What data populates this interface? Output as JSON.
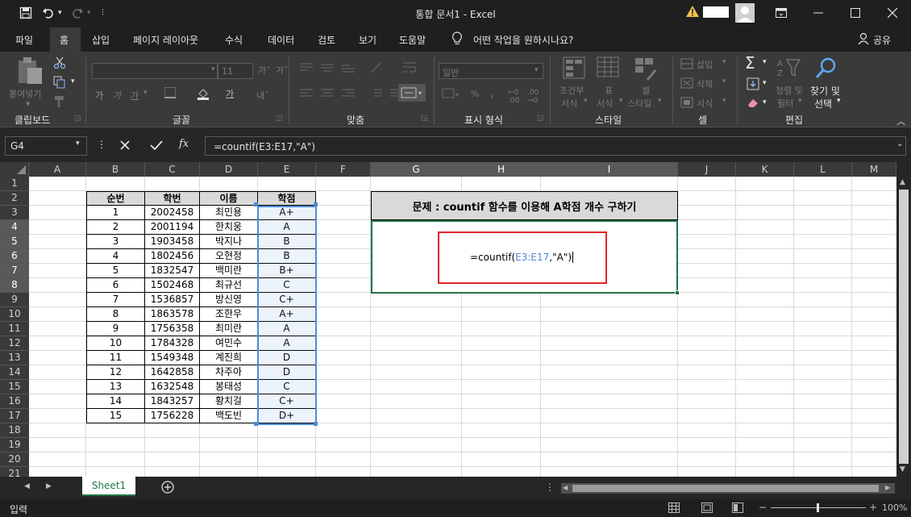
{
  "titlebar": {
    "doc_title": "통합 문서1 - Excel",
    "warning_icon": "warning-icon",
    "account_label": ""
  },
  "menu": {
    "tabs": [
      "파일",
      "홈",
      "삽입",
      "페이지 레이아웃",
      "수식",
      "데이터",
      "검토",
      "보기",
      "도움말"
    ],
    "tell_me": "어떤 작업을 원하시나요?",
    "share": "공유"
  },
  "ribbon": {
    "groups": [
      "클립보드",
      "글꼴",
      "맞춤",
      "표시 형식",
      "스타일",
      "셀",
      "편집"
    ],
    "paste": "붙여넣기",
    "font_size": "11",
    "number_format": "일반",
    "cond_format": [
      "조건부",
      "서식"
    ],
    "table_format": [
      "표",
      "서식"
    ],
    "cell_style": [
      "셀",
      "스타일"
    ],
    "insert": "삽입",
    "delete": "삭제",
    "format": "서식",
    "sort_filter": [
      "정렬 및",
      "필터"
    ],
    "find_select": [
      "찾기 및",
      "선택"
    ]
  },
  "formula_bar": {
    "name_box": "G4",
    "fx": "fx",
    "formula": "=countif(E3:E17,\"A\")"
  },
  "grid": {
    "columns": [
      "A",
      "B",
      "C",
      "D",
      "E",
      "F",
      "G",
      "H",
      "I",
      "J",
      "K",
      "L",
      "M"
    ],
    "rows": [
      "1",
      "2",
      "3",
      "4",
      "5",
      "6",
      "7",
      "8",
      "9",
      "10",
      "11",
      "12",
      "13",
      "14",
      "15",
      "16",
      "17",
      "18",
      "19",
      "20",
      "21"
    ]
  },
  "table": {
    "headers": [
      "순번",
      "학번",
      "이름",
      "학점"
    ],
    "rows": [
      [
        "1",
        "2002458",
        "최민용",
        "A+"
      ],
      [
        "2",
        "2001194",
        "한치웅",
        "A"
      ],
      [
        "3",
        "1903458",
        "박지나",
        "B"
      ],
      [
        "4",
        "1802456",
        "오현정",
        "B"
      ],
      [
        "5",
        "1832547",
        "백미란",
        "B+"
      ],
      [
        "6",
        "1502468",
        "최규선",
        "C"
      ],
      [
        "7",
        "1536857",
        "방신영",
        "C+"
      ],
      [
        "8",
        "1863578",
        "조한우",
        "A+"
      ],
      [
        "9",
        "1756358",
        "최미란",
        "A"
      ],
      [
        "10",
        "1784328",
        "여민수",
        "A"
      ],
      [
        "11",
        "1549348",
        "계진희",
        "D"
      ],
      [
        "12",
        "1642858",
        "차주아",
        "D"
      ],
      [
        "13",
        "1632548",
        "봉태성",
        "C"
      ],
      [
        "14",
        "1843257",
        "황치걸",
        "C+"
      ],
      [
        "15",
        "1756228",
        "백도빈",
        "D+"
      ]
    ]
  },
  "problem": {
    "title": "문제 : countif 함수를 이용해 A학점 개수 구하기",
    "formula_prefix": "=countif(",
    "formula_ref": "E3:E17",
    "formula_suffix": ",\"A\")"
  },
  "sheets": {
    "active": "Sheet1"
  },
  "status": {
    "mode": "입력",
    "zoom": "100%"
  },
  "colors": {
    "ref_blue": "#4e8bd4",
    "highlight_red": "#e0242c",
    "selection_green": "#217346"
  }
}
